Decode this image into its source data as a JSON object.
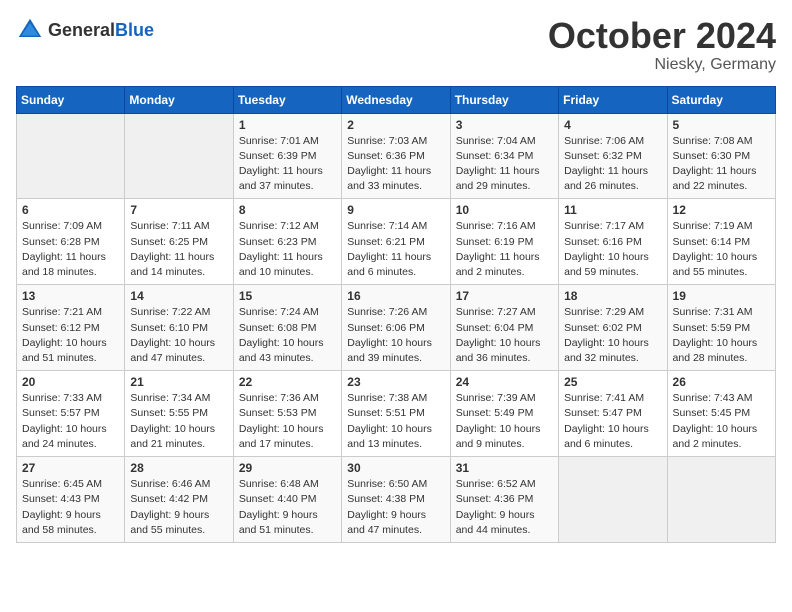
{
  "header": {
    "logo_general": "General",
    "logo_blue": "Blue",
    "month": "October 2024",
    "location": "Niesky, Germany"
  },
  "days_of_week": [
    "Sunday",
    "Monday",
    "Tuesday",
    "Wednesday",
    "Thursday",
    "Friday",
    "Saturday"
  ],
  "weeks": [
    [
      {
        "day": "",
        "sunrise": "",
        "sunset": "",
        "daylight": "",
        "empty": true
      },
      {
        "day": "",
        "sunrise": "",
        "sunset": "",
        "daylight": "",
        "empty": true
      },
      {
        "day": "1",
        "sunrise": "Sunrise: 7:01 AM",
        "sunset": "Sunset: 6:39 PM",
        "daylight": "Daylight: 11 hours and 37 minutes."
      },
      {
        "day": "2",
        "sunrise": "Sunrise: 7:03 AM",
        "sunset": "Sunset: 6:36 PM",
        "daylight": "Daylight: 11 hours and 33 minutes."
      },
      {
        "day": "3",
        "sunrise": "Sunrise: 7:04 AM",
        "sunset": "Sunset: 6:34 PM",
        "daylight": "Daylight: 11 hours and 29 minutes."
      },
      {
        "day": "4",
        "sunrise": "Sunrise: 7:06 AM",
        "sunset": "Sunset: 6:32 PM",
        "daylight": "Daylight: 11 hours and 26 minutes."
      },
      {
        "day": "5",
        "sunrise": "Sunrise: 7:08 AM",
        "sunset": "Sunset: 6:30 PM",
        "daylight": "Daylight: 11 hours and 22 minutes."
      }
    ],
    [
      {
        "day": "6",
        "sunrise": "Sunrise: 7:09 AM",
        "sunset": "Sunset: 6:28 PM",
        "daylight": "Daylight: 11 hours and 18 minutes."
      },
      {
        "day": "7",
        "sunrise": "Sunrise: 7:11 AM",
        "sunset": "Sunset: 6:25 PM",
        "daylight": "Daylight: 11 hours and 14 minutes."
      },
      {
        "day": "8",
        "sunrise": "Sunrise: 7:12 AM",
        "sunset": "Sunset: 6:23 PM",
        "daylight": "Daylight: 11 hours and 10 minutes."
      },
      {
        "day": "9",
        "sunrise": "Sunrise: 7:14 AM",
        "sunset": "Sunset: 6:21 PM",
        "daylight": "Daylight: 11 hours and 6 minutes."
      },
      {
        "day": "10",
        "sunrise": "Sunrise: 7:16 AM",
        "sunset": "Sunset: 6:19 PM",
        "daylight": "Daylight: 11 hours and 2 minutes."
      },
      {
        "day": "11",
        "sunrise": "Sunrise: 7:17 AM",
        "sunset": "Sunset: 6:16 PM",
        "daylight": "Daylight: 10 hours and 59 minutes."
      },
      {
        "day": "12",
        "sunrise": "Sunrise: 7:19 AM",
        "sunset": "Sunset: 6:14 PM",
        "daylight": "Daylight: 10 hours and 55 minutes."
      }
    ],
    [
      {
        "day": "13",
        "sunrise": "Sunrise: 7:21 AM",
        "sunset": "Sunset: 6:12 PM",
        "daylight": "Daylight: 10 hours and 51 minutes."
      },
      {
        "day": "14",
        "sunrise": "Sunrise: 7:22 AM",
        "sunset": "Sunset: 6:10 PM",
        "daylight": "Daylight: 10 hours and 47 minutes."
      },
      {
        "day": "15",
        "sunrise": "Sunrise: 7:24 AM",
        "sunset": "Sunset: 6:08 PM",
        "daylight": "Daylight: 10 hours and 43 minutes."
      },
      {
        "day": "16",
        "sunrise": "Sunrise: 7:26 AM",
        "sunset": "Sunset: 6:06 PM",
        "daylight": "Daylight: 10 hours and 39 minutes."
      },
      {
        "day": "17",
        "sunrise": "Sunrise: 7:27 AM",
        "sunset": "Sunset: 6:04 PM",
        "daylight": "Daylight: 10 hours and 36 minutes."
      },
      {
        "day": "18",
        "sunrise": "Sunrise: 7:29 AM",
        "sunset": "Sunset: 6:02 PM",
        "daylight": "Daylight: 10 hours and 32 minutes."
      },
      {
        "day": "19",
        "sunrise": "Sunrise: 7:31 AM",
        "sunset": "Sunset: 5:59 PM",
        "daylight": "Daylight: 10 hours and 28 minutes."
      }
    ],
    [
      {
        "day": "20",
        "sunrise": "Sunrise: 7:33 AM",
        "sunset": "Sunset: 5:57 PM",
        "daylight": "Daylight: 10 hours and 24 minutes."
      },
      {
        "day": "21",
        "sunrise": "Sunrise: 7:34 AM",
        "sunset": "Sunset: 5:55 PM",
        "daylight": "Daylight: 10 hours and 21 minutes."
      },
      {
        "day": "22",
        "sunrise": "Sunrise: 7:36 AM",
        "sunset": "Sunset: 5:53 PM",
        "daylight": "Daylight: 10 hours and 17 minutes."
      },
      {
        "day": "23",
        "sunrise": "Sunrise: 7:38 AM",
        "sunset": "Sunset: 5:51 PM",
        "daylight": "Daylight: 10 hours and 13 minutes."
      },
      {
        "day": "24",
        "sunrise": "Sunrise: 7:39 AM",
        "sunset": "Sunset: 5:49 PM",
        "daylight": "Daylight: 10 hours and 9 minutes."
      },
      {
        "day": "25",
        "sunrise": "Sunrise: 7:41 AM",
        "sunset": "Sunset: 5:47 PM",
        "daylight": "Daylight: 10 hours and 6 minutes."
      },
      {
        "day": "26",
        "sunrise": "Sunrise: 7:43 AM",
        "sunset": "Sunset: 5:45 PM",
        "daylight": "Daylight: 10 hours and 2 minutes."
      }
    ],
    [
      {
        "day": "27",
        "sunrise": "Sunrise: 6:45 AM",
        "sunset": "Sunset: 4:43 PM",
        "daylight": "Daylight: 9 hours and 58 minutes."
      },
      {
        "day": "28",
        "sunrise": "Sunrise: 6:46 AM",
        "sunset": "Sunset: 4:42 PM",
        "daylight": "Daylight: 9 hours and 55 minutes."
      },
      {
        "day": "29",
        "sunrise": "Sunrise: 6:48 AM",
        "sunset": "Sunset: 4:40 PM",
        "daylight": "Daylight: 9 hours and 51 minutes."
      },
      {
        "day": "30",
        "sunrise": "Sunrise: 6:50 AM",
        "sunset": "Sunset: 4:38 PM",
        "daylight": "Daylight: 9 hours and 47 minutes."
      },
      {
        "day": "31",
        "sunrise": "Sunrise: 6:52 AM",
        "sunset": "Sunset: 4:36 PM",
        "daylight": "Daylight: 9 hours and 44 minutes."
      },
      {
        "day": "",
        "sunrise": "",
        "sunset": "",
        "daylight": "",
        "empty": true
      },
      {
        "day": "",
        "sunrise": "",
        "sunset": "",
        "daylight": "",
        "empty": true
      }
    ]
  ]
}
